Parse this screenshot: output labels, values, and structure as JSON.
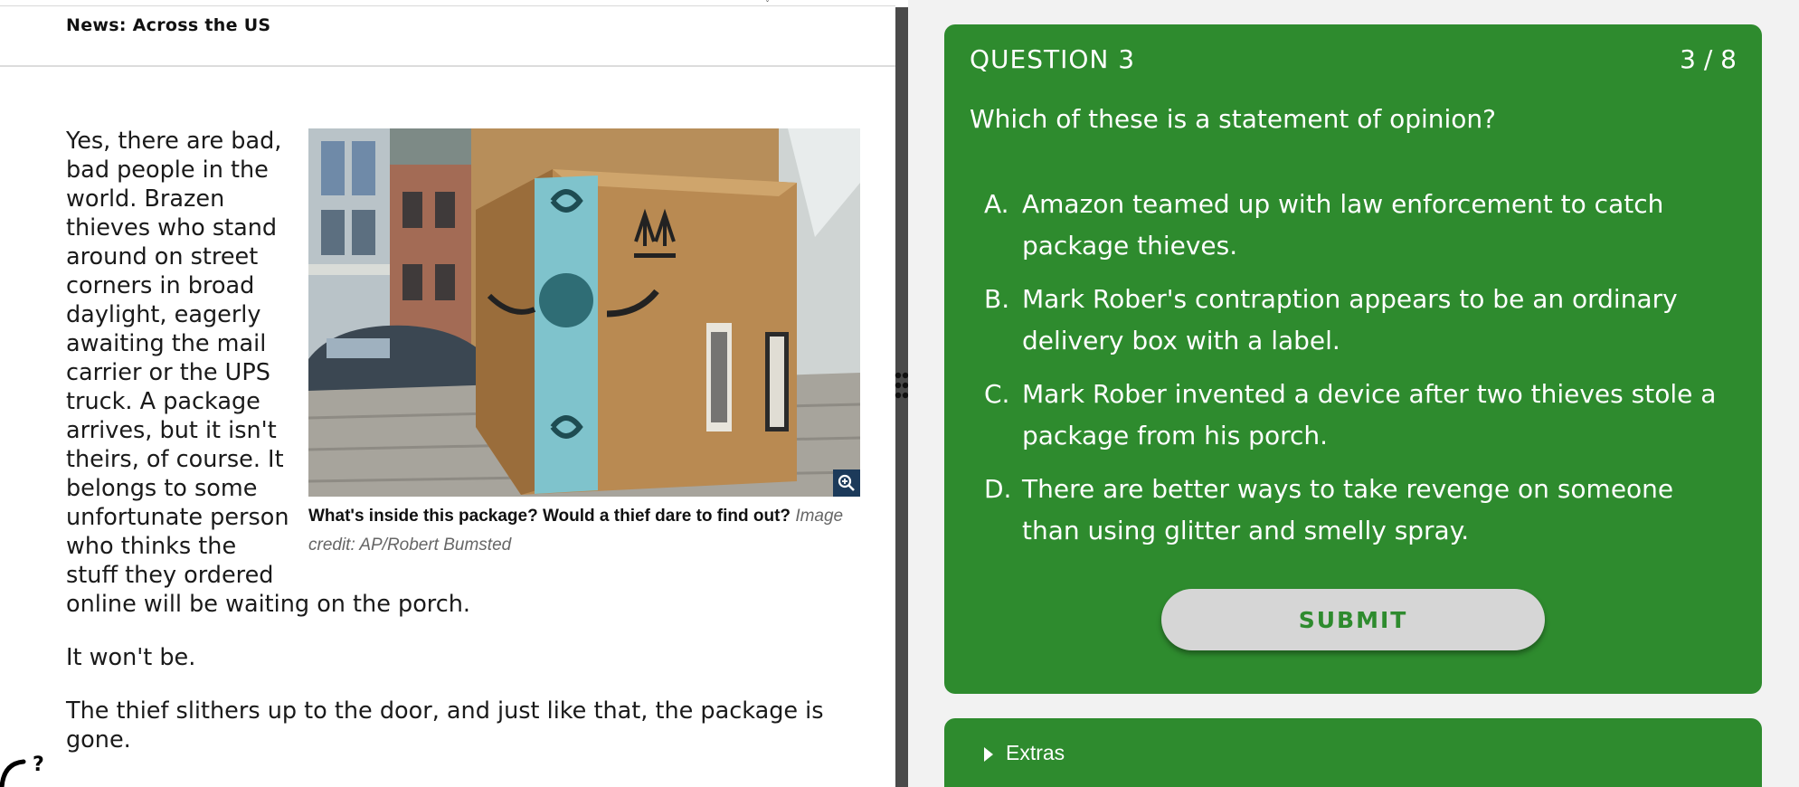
{
  "article": {
    "section_title": "News: Across the US",
    "paragraphs": [
      "Yes, there are bad, bad people in the world. Brazen thieves who stand around on street corners in broad daylight, eagerly awaiting the mail carrier or the UPS truck. A package arrives, but it isn't theirs, of course. It belongs to some unfortunate person who thinks the stuff they ordered online will be waiting on the porch.",
      "It won't be.",
      "The thief slithers up to the door, and just like that, the package is gone."
    ],
    "figure": {
      "caption": "What's inside this package? Would a thief dare to find out?",
      "credit": "Image credit: AP/Robert Bumsted"
    }
  },
  "quiz": {
    "question_label": "QUESTION 3",
    "progress": "3 / 8",
    "prompt": "Which of these is a statement of opinion?",
    "options": [
      {
        "letter": "A.",
        "text": "Amazon teamed up with law enforcement to catch package thieves."
      },
      {
        "letter": "B.",
        "text": "Mark Rober's contraption appears to be an ordinary delivery box with a label."
      },
      {
        "letter": "C.",
        "text": "Mark Rober invented a device after two thieves stole a package from his porch."
      },
      {
        "letter": "D.",
        "text": "There are better ways to take revenge on someone than using glitter and smelly spray."
      }
    ],
    "submit_label": "SUBMIT",
    "extras_label": "Extras"
  },
  "colors": {
    "quiz_green": "#2e8b2e",
    "submit_bg": "#d6d6d6",
    "splitter": "#4a4a4a",
    "right_bg": "#f2f2f2"
  },
  "icons": {
    "zoom": "zoom-in-icon",
    "help": "help-bubble-icon",
    "grip": "drag-handle-icon",
    "caret": "caret-right-icon"
  }
}
